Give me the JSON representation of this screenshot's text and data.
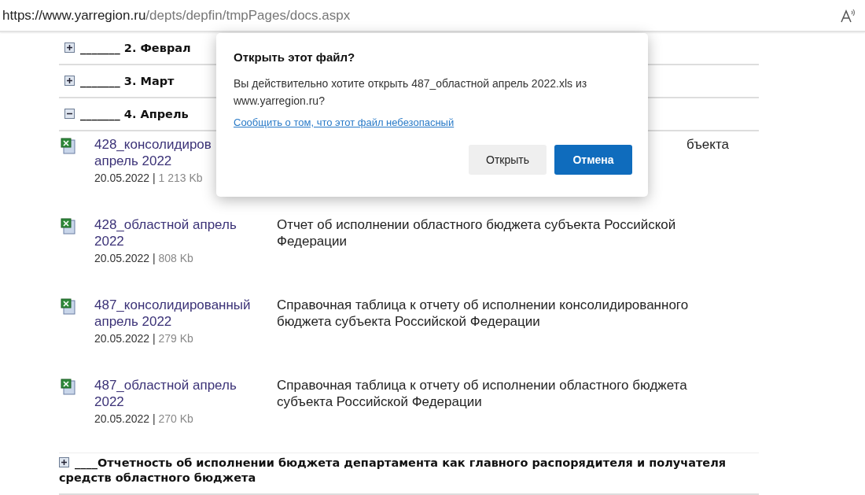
{
  "address_bar": {
    "url_host": "https://www.yarregion.ru",
    "url_path": "/depts/depfin/tmpPages/docs.aspx"
  },
  "sections": [
    {
      "title": "_______ 2. Феврал",
      "expanded": false
    },
    {
      "title": "_______ 3. Март",
      "expanded": false
    },
    {
      "title": "_______ 4. Апрель",
      "expanded": true,
      "files": [
        {
          "name": "428_консолидиров",
          "name_line_2": "апрель 2022",
          "date": "20.05.2022",
          "separator": "|",
          "size": "1 213 Kb",
          "description": "бъекта",
          "cut": true
        },
        {
          "name": "428_областной апрель 2022",
          "date": "20.05.2022",
          "separator": "|",
          "size": "808 Kb",
          "description": "Отчет об исполнении областного бюджета субъекта Российской Федерации",
          "cut": false
        },
        {
          "name": "487_консолидированный апрель 2022",
          "date": "20.05.2022",
          "separator": "|",
          "size": "279 Kb",
          "description": "Справочная таблица к отчету об исполнении консолидированного бюджета субъекта Российской Федерации",
          "cut": false
        },
        {
          "name": "487_областной апрель 2022",
          "date": "20.05.2022",
          "separator": "|",
          "size": "270 Kb",
          "description": "Справочная таблица к отчету об исполнении областного бюджета субъекта Российской Федерации",
          "cut": false
        }
      ]
    },
    {
      "title": "____Отчетность об исполнении бюджета департамента как главного распорядителя и получателя средств областного бюджета",
      "expanded": false
    }
  ],
  "dialog": {
    "title": "Открыть этот файл?",
    "message": "Вы действительно хотите открыть 487_областной апрель 2022.xls из www.yarregion.ru?",
    "report_link": "Сообщить о том, что этот файл небезопасный",
    "buttons": [
      {
        "label": "Открыть",
        "primary": false
      },
      {
        "label": "Отмена",
        "primary": true
      }
    ]
  }
}
